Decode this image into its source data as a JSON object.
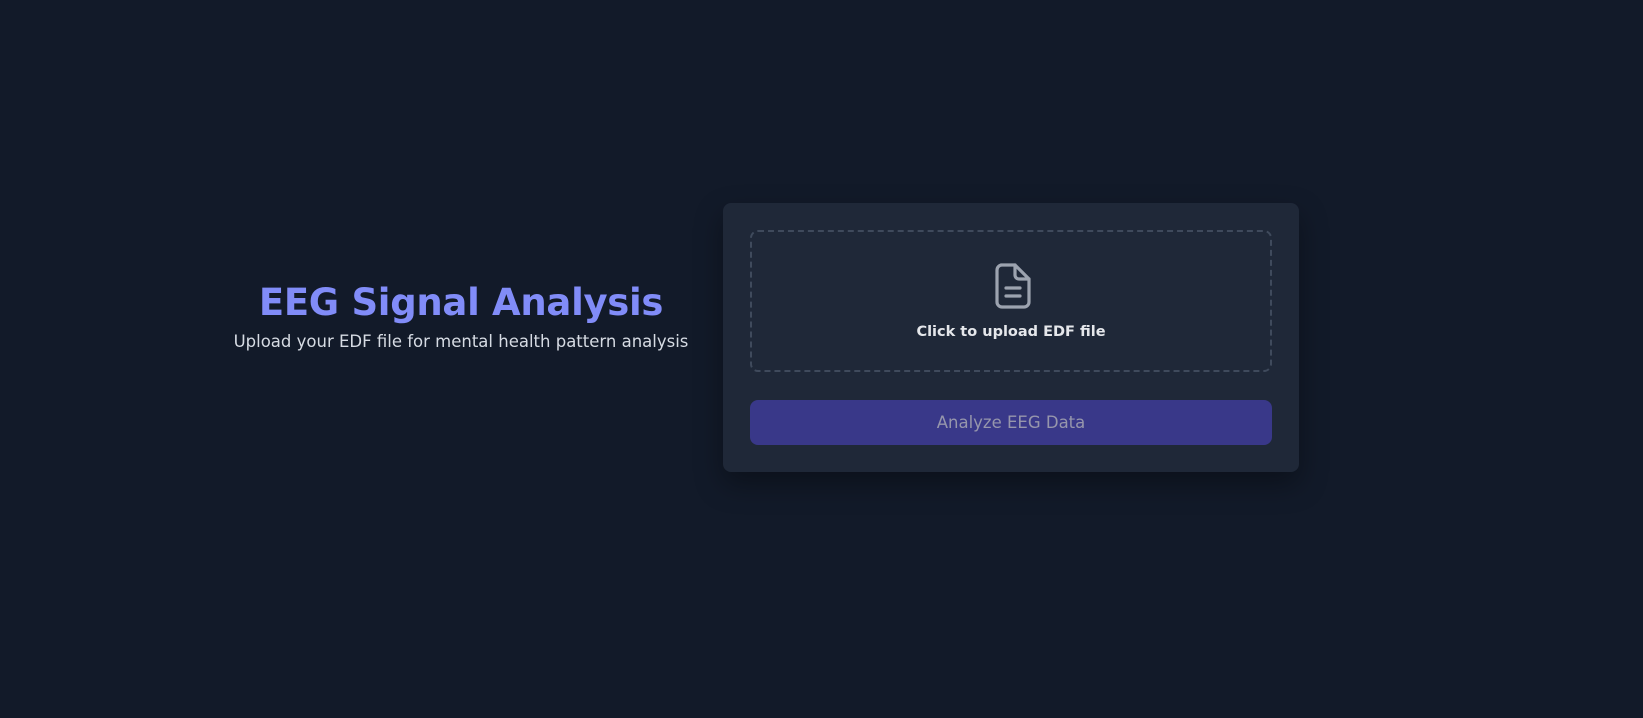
{
  "intro": {
    "title": "EEG Signal Analysis",
    "subtitle": "Upload your EDF file for mental health pattern analysis"
  },
  "upload": {
    "icon": "file-text-icon",
    "label": "Click to upload EDF file"
  },
  "actions": {
    "analyze_label": "Analyze EEG Data",
    "analyze_disabled": true
  },
  "colors": {
    "background": "#121a29",
    "card": "#1f2838",
    "accent": "#818cf8",
    "button": "#393889",
    "button_text": "#9696ac"
  }
}
